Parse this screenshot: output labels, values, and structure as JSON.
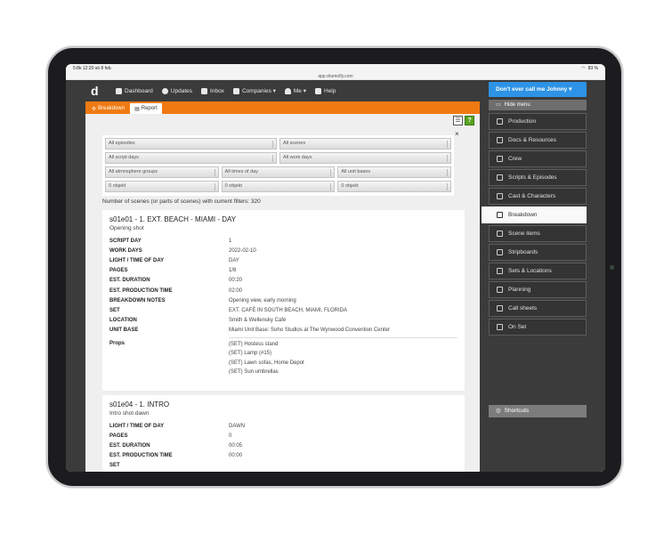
{
  "status": {
    "time": "5:8k  12:20  sö 8 feb.",
    "battery": "83 %"
  },
  "url": "app.drumolfy.com",
  "nav": {
    "items": [
      {
        "label": "Dashboard",
        "icon": "dashboard-icon"
      },
      {
        "label": "Updates",
        "icon": "updates-icon"
      },
      {
        "label": "Inbox",
        "icon": "inbox-icon"
      },
      {
        "label": "Companies ▾",
        "icon": "companies-icon"
      },
      {
        "label": "Me ▾",
        "icon": "user-icon"
      },
      {
        "label": "Help",
        "icon": "help-icon"
      }
    ]
  },
  "tabs": {
    "breakdown": "Breakdown",
    "report": "Report"
  },
  "filters": {
    "episodes": "All episodes",
    "scenes": "All scenes",
    "script_days": "All script days",
    "work_days": "All work days",
    "atmosphere": "All atmosphere groups",
    "times": "All times of day",
    "unit_bases": "All unit bases",
    "obj1": "0 objekt",
    "obj2": "0 objekt",
    "obj3": "0 objekt"
  },
  "count_text": "Number of scenes (or parts of scenes) with current filters: 320",
  "scene1": {
    "title": "s01e01 - 1. EXT. BEACH - MIAMI - DAY",
    "subtitle": "Opening shot",
    "rows": [
      {
        "k": "SCRIPT DAY",
        "v": "1"
      },
      {
        "k": "WORK DAYS",
        "v": "2022-02-10"
      },
      {
        "k": "LIGHT / TIME OF DAY",
        "v": "DAY"
      },
      {
        "k": "PAGES",
        "v": "1/8"
      },
      {
        "k": "EST. DURATION",
        "v": "00:20"
      },
      {
        "k": "EST. PRODUCTION TIME",
        "v": "02:00"
      },
      {
        "k": "BREAKDOWN NOTES",
        "v": "Opening view, early morning"
      },
      {
        "k": "SET",
        "v": "EXT. CAFÉ IN SOUTH BEACH, MIAMI, FLORIDA"
      },
      {
        "k": "LOCATION",
        "v": "Smith & Wellensky Café"
      },
      {
        "k": "UNIT BASE",
        "v": "Miami Unit Base: Soho Studios at The Wynwood Convention Center"
      }
    ],
    "props_label": "Props",
    "props": [
      "(SET) Hostess stand",
      "(SET) Lamp (#15)",
      "(SET) Lawn sofas, Home Depot",
      "(SET) Sun umbrellas"
    ]
  },
  "scene2": {
    "title": "s01e04 - 1. INTRO",
    "subtitle": "Intro shot dawn",
    "rows": [
      {
        "k": "LIGHT / TIME OF DAY",
        "v": "DAWN"
      },
      {
        "k": "PAGES",
        "v": "0"
      },
      {
        "k": "EST. DURATION",
        "v": "00:05"
      },
      {
        "k": "EST. PRODUCTION TIME",
        "v": "00:00"
      },
      {
        "k": "SET",
        "v": ""
      }
    ]
  },
  "sidebar": {
    "user": "Don't ever call me Johnny ▾",
    "hide_menu": "Hide menu",
    "items": [
      {
        "label": "Production",
        "icon": "production-icon"
      },
      {
        "label": "Docs & Resources",
        "icon": "docs-icon"
      },
      {
        "label": "Crew",
        "icon": "crew-icon"
      },
      {
        "label": "Scripts & Episodes",
        "icon": "scripts-icon"
      },
      {
        "label": "Cast & Characters",
        "icon": "cast-icon"
      },
      {
        "label": "Breakdown",
        "icon": "breakdown-icon",
        "active": true
      },
      {
        "label": "Scene items",
        "icon": "scene-items-icon"
      },
      {
        "label": "Stripboards",
        "icon": "stripboards-icon"
      },
      {
        "label": "Sets & Locations",
        "icon": "sets-icon"
      },
      {
        "label": "Planning",
        "icon": "planning-icon"
      },
      {
        "label": "Call sheets",
        "icon": "call-sheets-icon"
      },
      {
        "label": "On Set",
        "icon": "on-set-icon"
      }
    ],
    "shortcuts": "Shortcuts"
  }
}
